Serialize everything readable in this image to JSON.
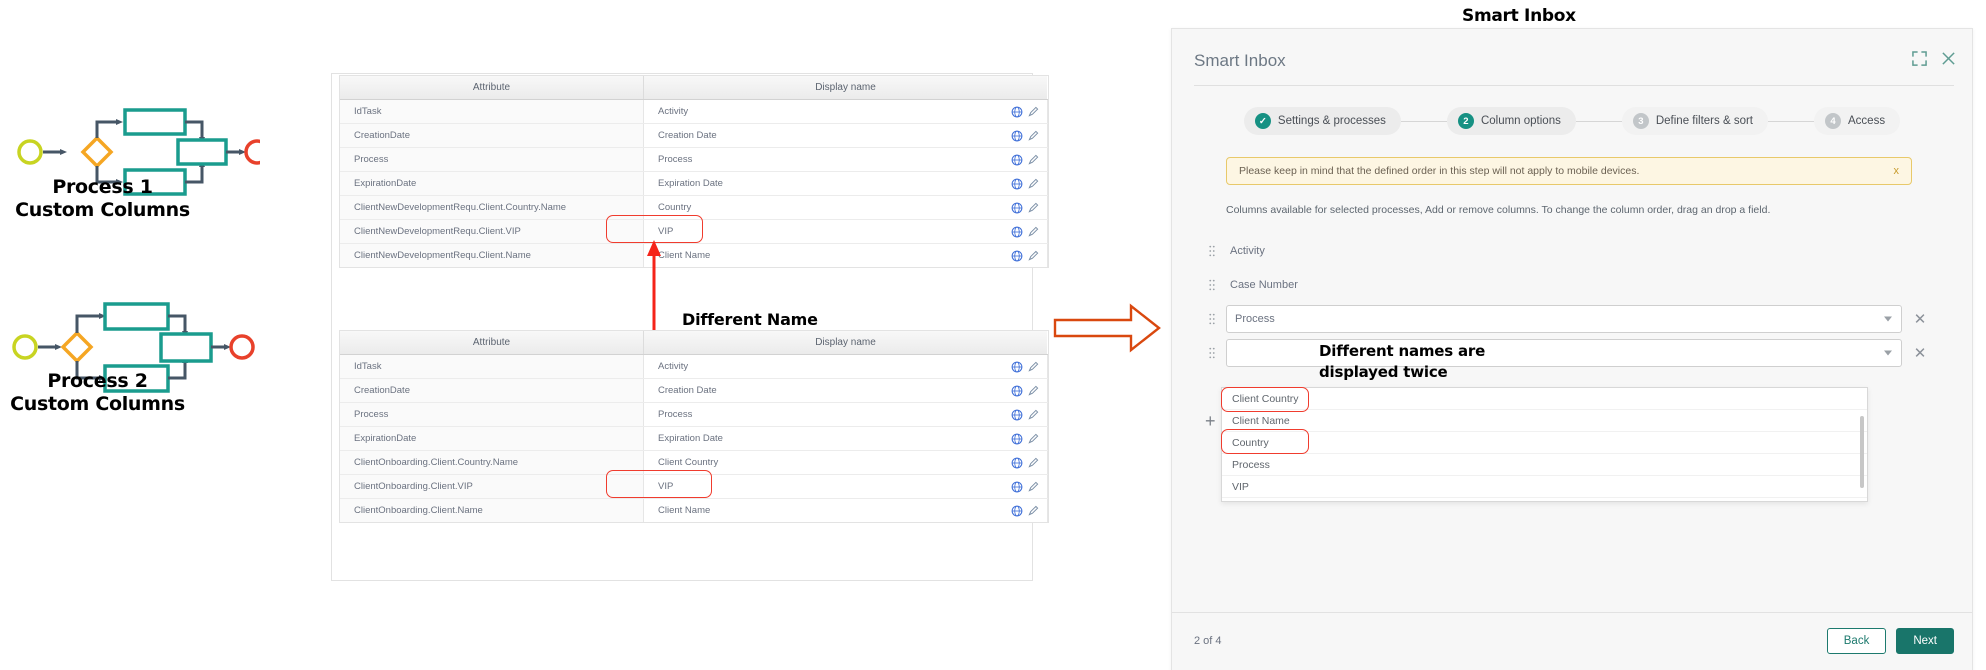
{
  "top_label": "Smart Inbox",
  "diagrams": [
    {
      "caption_line1": "Process 1",
      "caption_line2": "Custom Columns"
    },
    {
      "caption_line2": "Custom Columns",
      "caption_line1": "Process 2"
    }
  ],
  "annotations": {
    "different_name": "Different Name",
    "different_names_twice_line1": "Different names are",
    "different_names_twice_line2": "displayed twice"
  },
  "tables": [
    {
      "headers": [
        "Attribute",
        "Display name"
      ],
      "rows": [
        {
          "attribute": "IdTask",
          "display": "Activity"
        },
        {
          "attribute": "CreationDate",
          "display": "Creation Date"
        },
        {
          "attribute": "Process",
          "display": "Process"
        },
        {
          "attribute": "ExpirationDate",
          "display": "Expiration Date"
        },
        {
          "attribute": "ClientNewDevelopmentRequ.Client.Country.Name",
          "display": "Country"
        },
        {
          "attribute": "ClientNewDevelopmentRequ.Client.VIP",
          "display": "VIP"
        },
        {
          "attribute": "ClientNewDevelopmentRequ.Client.Name",
          "display": "Client Name"
        }
      ]
    },
    {
      "headers": [
        "Attribute",
        "Display name"
      ],
      "rows": [
        {
          "attribute": "IdTask",
          "display": "Activity"
        },
        {
          "attribute": "CreationDate",
          "display": "Creation Date"
        },
        {
          "attribute": "Process",
          "display": "Process"
        },
        {
          "attribute": "ExpirationDate",
          "display": "Expiration Date"
        },
        {
          "attribute": "ClientOnboarding.Client.Country.Name",
          "display": "Client Country"
        },
        {
          "attribute": "ClientOnboarding.Client.VIP",
          "display": "VIP"
        },
        {
          "attribute": "ClientOnboarding.Client.Name",
          "display": "Client Name"
        }
      ]
    }
  ],
  "dialog": {
    "title": "Smart Inbox",
    "expand_icon": "expand-icon",
    "close_icon": "close-icon",
    "steps": [
      {
        "num": "1",
        "label": "Settings & processes",
        "state": "done"
      },
      {
        "num": "2",
        "label": "Column options",
        "state": "active"
      },
      {
        "num": "3",
        "label": "Define filters & sort",
        "state": "todo"
      },
      {
        "num": "4",
        "label": "Access",
        "state": "todo"
      }
    ],
    "notice": {
      "text": "Please keep in mind that the defined order in this step will not apply to mobile devices.",
      "close": "x"
    },
    "helper_text": "Columns available for selected processes, Add or remove columns. To change the column order, drag an drop a field.",
    "columns": [
      {
        "type": "static",
        "label": "Activity"
      },
      {
        "type": "static",
        "label": "Case Number"
      },
      {
        "type": "select",
        "value": "Process"
      },
      {
        "type": "select",
        "value": ""
      }
    ],
    "dropdown_options": [
      "Client Country",
      "Client Name",
      "Country",
      "Process",
      "VIP"
    ],
    "add_button": "+",
    "page_count": "2 of 4",
    "back_label": "Back",
    "next_label": "Next"
  },
  "colors": {
    "teal": "#1a9c8e",
    "orange": "#f5a623",
    "red": "#e8412b",
    "green_yellow": "#c8d422",
    "arrow_gray": "#465666",
    "accent_green": "#19756a",
    "highlight_red": "#f03c2e",
    "notice_bg": "#fdf6e3"
  }
}
